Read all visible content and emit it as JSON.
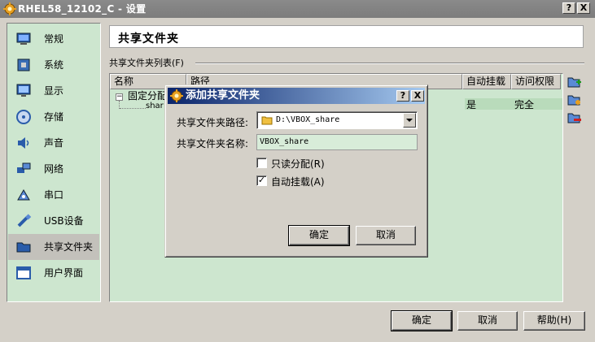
{
  "window": {
    "title": "RHEL58_12102_C - 设置",
    "help_btn": "?",
    "close_btn": "X"
  },
  "sidebar": {
    "items": [
      {
        "label": "常规",
        "icon": "general-icon"
      },
      {
        "label": "系统",
        "icon": "system-icon"
      },
      {
        "label": "显示",
        "icon": "display-icon"
      },
      {
        "label": "存储",
        "icon": "storage-icon"
      },
      {
        "label": "声音",
        "icon": "audio-icon"
      },
      {
        "label": "网络",
        "icon": "network-icon"
      },
      {
        "label": "串口",
        "icon": "serial-port-icon"
      },
      {
        "label": "USB设备",
        "icon": "usb-icon"
      },
      {
        "label": "共享文件夹",
        "icon": "shared-folder-icon",
        "selected": true
      },
      {
        "label": "用户界面",
        "icon": "user-interface-icon"
      }
    ]
  },
  "page": {
    "title": "共享文件夹",
    "list_group_label": "共享文件夹列表(F)",
    "columns": [
      "名称",
      "路径",
      "自动挂载",
      "访问权限"
    ],
    "group_row": "固定分配",
    "share_row": {
      "name": "shar",
      "auto_mount": "是",
      "access": "完全"
    }
  },
  "buttons": {
    "ok": "确定",
    "cancel": "取消",
    "help": "帮助(H)"
  },
  "dialog": {
    "title": "添加共享文件夹",
    "help_btn": "?",
    "close_btn": "X",
    "path_label": "共享文件夹路径:",
    "path_value": "D:\\VBOX_share",
    "name_label": "共享文件夹名称:",
    "name_value": "VBOX_share",
    "readonly_label": "只读分配(R)",
    "readonly_checked": false,
    "automount_label": "自动挂载(A)",
    "automount_checked": true,
    "ok": "确定",
    "cancel": "取消"
  },
  "colors": {
    "list_background": "#cde6cf",
    "dialog_title_start": "#0a246a",
    "dialog_title_end": "#a6caf0",
    "inactive_title": "#808080"
  }
}
